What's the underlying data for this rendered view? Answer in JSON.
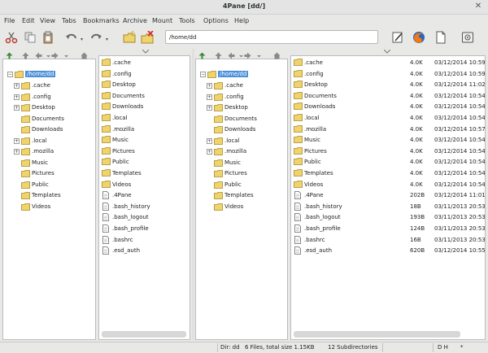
{
  "window": {
    "title": "4Pane [dd/]"
  },
  "menubar": [
    "File",
    "Edit",
    "View",
    "Tabs",
    "Bookmarks",
    "Archive",
    "Mount",
    "Tools",
    "Options",
    "Help"
  ],
  "toolbar": {
    "path": "/home/dd"
  },
  "colors": {
    "folder": "#f0d36c",
    "folder_edge": "#a58a2a",
    "selection": "#4a90d9",
    "accent": "#e8e8e7"
  },
  "icons": [
    "cut-icon",
    "copy-icon",
    "paste-icon",
    "undo-icon",
    "redo-icon",
    "new-folder-icon",
    "delete-icon",
    "editor-icon",
    "firefox-icon",
    "new-document-icon",
    "terminal-icon"
  ],
  "tree": {
    "root": "/home/dd",
    "items": [
      {
        "name": ".cache",
        "expandable": true
      },
      {
        "name": ".config",
        "expandable": true
      },
      {
        "name": "Desktop",
        "expandable": true
      },
      {
        "name": "Documents",
        "expandable": false
      },
      {
        "name": "Downloads",
        "expandable": false
      },
      {
        "name": ".local",
        "expandable": true
      },
      {
        "name": ".mozilla",
        "expandable": true
      },
      {
        "name": "Music",
        "expandable": false
      },
      {
        "name": "Pictures",
        "expandable": false
      },
      {
        "name": "Public",
        "expandable": false
      },
      {
        "name": "Templates",
        "expandable": false
      },
      {
        "name": "Videos",
        "expandable": false
      }
    ]
  },
  "files": {
    "items": [
      {
        "name": ".cache",
        "type": "folder",
        "size": "4.0K",
        "date": "03/12/2014 10:59"
      },
      {
        "name": ".config",
        "type": "folder",
        "size": "4.0K",
        "date": "03/12/2014 10:59"
      },
      {
        "name": "Desktop",
        "type": "folder",
        "size": "4.0K",
        "date": "03/12/2014 11:02"
      },
      {
        "name": "Documents",
        "type": "folder",
        "size": "4.0K",
        "date": "03/12/2014 10:54"
      },
      {
        "name": "Downloads",
        "type": "folder",
        "size": "4.0K",
        "date": "03/12/2014 10:54"
      },
      {
        "name": ".local",
        "type": "folder",
        "size": "4.0K",
        "date": "03/12/2014 10:54"
      },
      {
        "name": ".mozilla",
        "type": "folder",
        "size": "4.0K",
        "date": "03/12/2014 10:57"
      },
      {
        "name": "Music",
        "type": "folder",
        "size": "4.0K",
        "date": "03/12/2014 10:54"
      },
      {
        "name": "Pictures",
        "type": "folder",
        "size": "4.0K",
        "date": "03/12/2014 10:54"
      },
      {
        "name": "Public",
        "type": "folder",
        "size": "4.0K",
        "date": "03/12/2014 10:54"
      },
      {
        "name": "Templates",
        "type": "folder",
        "size": "4.0K",
        "date": "03/12/2014 10:54"
      },
      {
        "name": "Videos",
        "type": "folder",
        "size": "4.0K",
        "date": "03/12/2014 10:54"
      },
      {
        "name": ".4Pane",
        "type": "file",
        "size": "202B",
        "date": "03/12/2014 11:01"
      },
      {
        "name": ".bash_history",
        "type": "file",
        "size": "18B",
        "date": "03/11/2013 20:53"
      },
      {
        "name": ".bash_logout",
        "type": "file",
        "size": "193B",
        "date": "03/11/2013 20:53"
      },
      {
        "name": ".bash_profile",
        "type": "file",
        "size": "124B",
        "date": "03/11/2013 20:53"
      },
      {
        "name": ".bashrc",
        "type": "file",
        "size": "16B",
        "date": "03/11/2013 20:53"
      },
      {
        "name": ".esd_auth",
        "type": "file",
        "size": "620B",
        "date": "03/12/2014 10:55"
      }
    ]
  },
  "status": {
    "dir": "Dir: dd",
    "summary": "6 Files, total size 1.15KB",
    "subdirs": "12 Subdirectories",
    "filter": "D H",
    "extra": "*"
  }
}
